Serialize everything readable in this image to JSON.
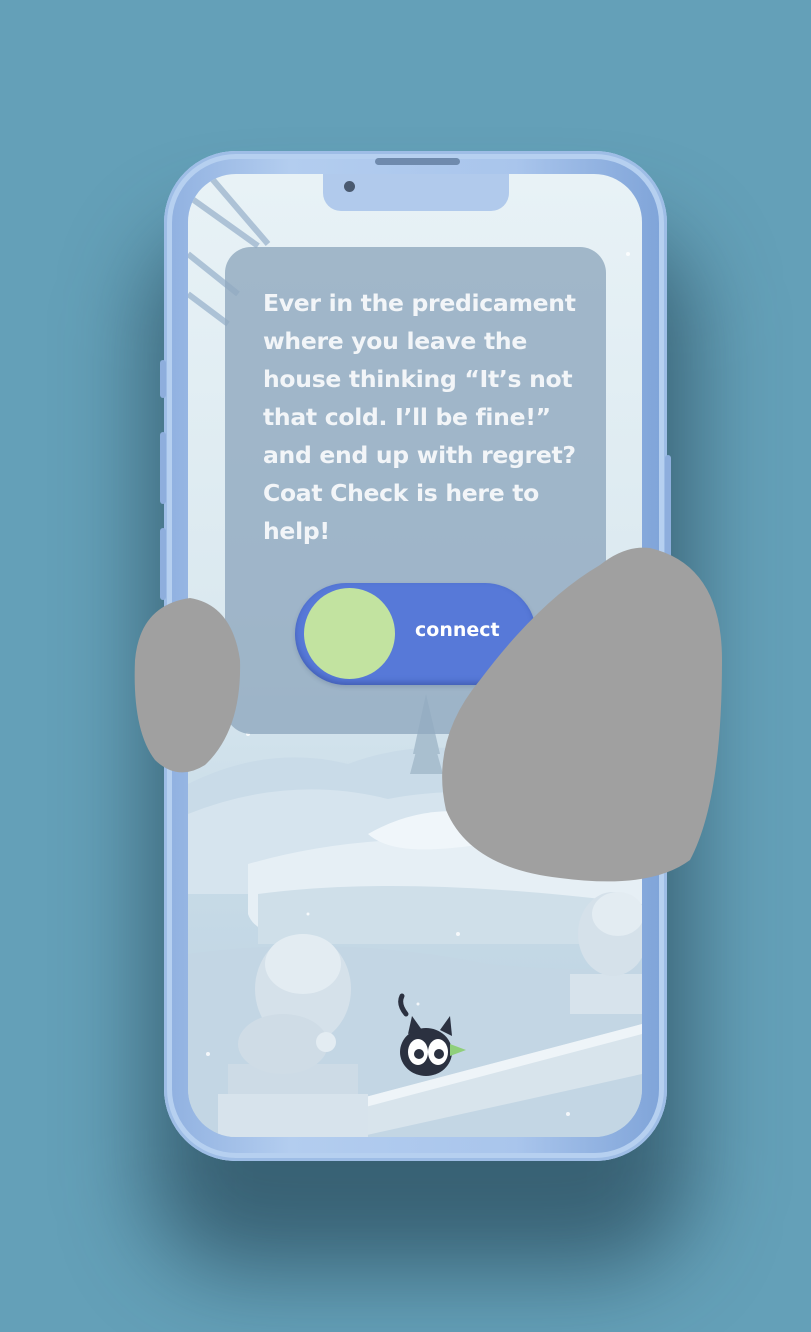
{
  "card": {
    "text": "Ever in the predicament where you leave the house thinking “It’s not that cold. I’ll be fine!” and end up with regret? Coat Check is here to help!"
  },
  "toggle": {
    "label": "connect",
    "state": "off"
  },
  "icons": {
    "cat": "cat-mascot-icon"
  },
  "colors": {
    "background": "#64a0b8",
    "phone_frame": "#a9c5ec",
    "card": "#91aac0",
    "toggle_track": "#5779d8",
    "toggle_knob": "#c2e3a0",
    "card_text": "#f2f5f8"
  }
}
